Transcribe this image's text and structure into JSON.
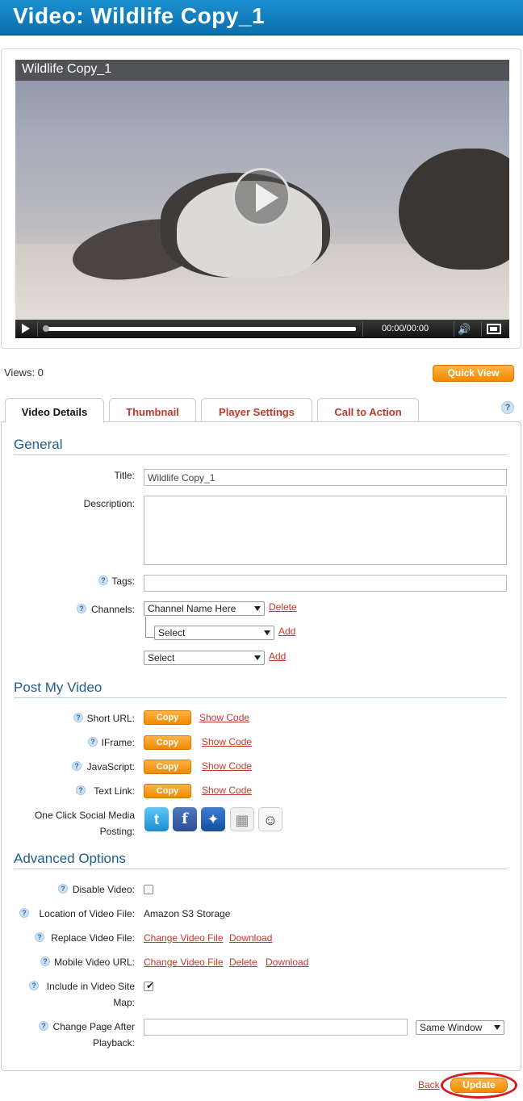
{
  "header": {
    "title": "Video: Wildlife Copy_1"
  },
  "player": {
    "overlay_title": "Wildlife Copy_1",
    "time": "00:00/00:00",
    "progress": 0,
    "icons": [
      "play-icon",
      "volume-icon",
      "fullscreen-icon",
      "big-play-icon"
    ]
  },
  "stats": {
    "views": "Views: 0"
  },
  "quick_view_label": "Quick View",
  "help_symbol": "?",
  "tabs": [
    {
      "label": "Video Details",
      "active": true
    },
    {
      "label": "Thumbnail",
      "active": false
    },
    {
      "label": "Player Settings",
      "active": false
    },
    {
      "label": "Call to Action",
      "active": false
    }
  ],
  "general": {
    "heading": "General",
    "title_label": "Title:",
    "title_value": "Wildlife Copy_1",
    "description_label": "Description:",
    "description_value": "",
    "tags_label": "Tags:",
    "tags_value": "",
    "channels_label": "Channels:",
    "channel_selected": "Channel Name Here",
    "delete_label": "Delete",
    "sub_select": "Select",
    "add_label": "Add",
    "select2": "Select",
    "add2_label": "Add"
  },
  "post": {
    "heading": "Post My Video",
    "rows": [
      {
        "label": "Short URL:",
        "copy": "Copy",
        "show": "Show Code"
      },
      {
        "label": "IFrame:",
        "copy": "Copy",
        "show": "Show Code"
      },
      {
        "label": "JavaScript:",
        "copy": "Copy",
        "show": "Show Code"
      },
      {
        "label": "Text Link:",
        "copy": "Copy",
        "show": "Show Code"
      }
    ],
    "social_label_1": "One Click Social Media",
    "social_label_2": "Posting:",
    "social_icons": [
      "twitter-icon",
      "facebook-icon",
      "myspace-icon",
      "digg-icon",
      "reddit-icon"
    ]
  },
  "advanced": {
    "heading": "Advanced Options",
    "disable_label": "Disable Video:",
    "disable_checked": false,
    "location_label": "Location of Video File:",
    "location_value": "Amazon S3 Storage",
    "replace_label": "Replace Video File:",
    "change_video_file": "Change Video File",
    "download": "Download",
    "mobile_label": "Mobile Video URL:",
    "mobile_change": "Change Video File",
    "mobile_delete": "Delete",
    "mobile_download": "Download",
    "sitemap_label_1": "Include in Video Site",
    "sitemap_label_2": "Map:",
    "sitemap_checked": true,
    "change_page_label_1": "Change Page After",
    "change_page_label_2": "Playback:",
    "change_page_value": "",
    "window_select": "Same Window"
  },
  "footer": {
    "back": "Back",
    "update": "Update"
  }
}
